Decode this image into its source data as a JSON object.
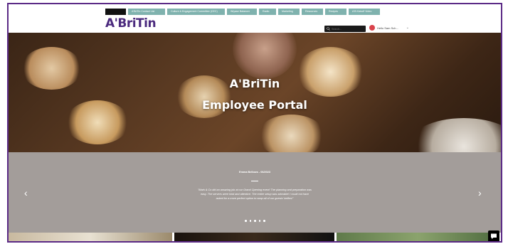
{
  "nav": {
    "items": [
      {
        "label": ""
      },
      {
        "label": "A'BriTin Contact List"
      },
      {
        "label": "Culture & Engagement Committee (CEC)"
      },
      {
        "label": "Wiyase Balancer"
      },
      {
        "label": "Radio"
      },
      {
        "label": "Marketing"
      },
      {
        "label": "Resources"
      },
      {
        "label": "Recipes"
      },
      {
        "label": "A'B Kickoff Video"
      }
    ]
  },
  "brand": {
    "logo_text": "A'BriTin",
    "color": "#4b2a7e"
  },
  "search": {
    "placeholder": "Search..."
  },
  "user": {
    "name": "Hello Sam Sch..."
  },
  "hero": {
    "line1": "A'BriTin",
    "line2": "Employee Portal"
  },
  "testimonial": {
    "author": "Emma Bellows - 06/2023",
    "quote": "\"Mark & Co did an amazing job at our Grand Opening event! The planning and preparation was easy. The servers were kind and attentive. The entire setup was adorable! I could not have asked for a more perfect option to wrap all of our guests' bellies!\"",
    "prev": "‹",
    "next": "›",
    "dots": 5
  },
  "colors": {
    "accent": "#7fb2ae",
    "frame": "#5b2a86",
    "testimonial_bg": "#a39d9a"
  }
}
